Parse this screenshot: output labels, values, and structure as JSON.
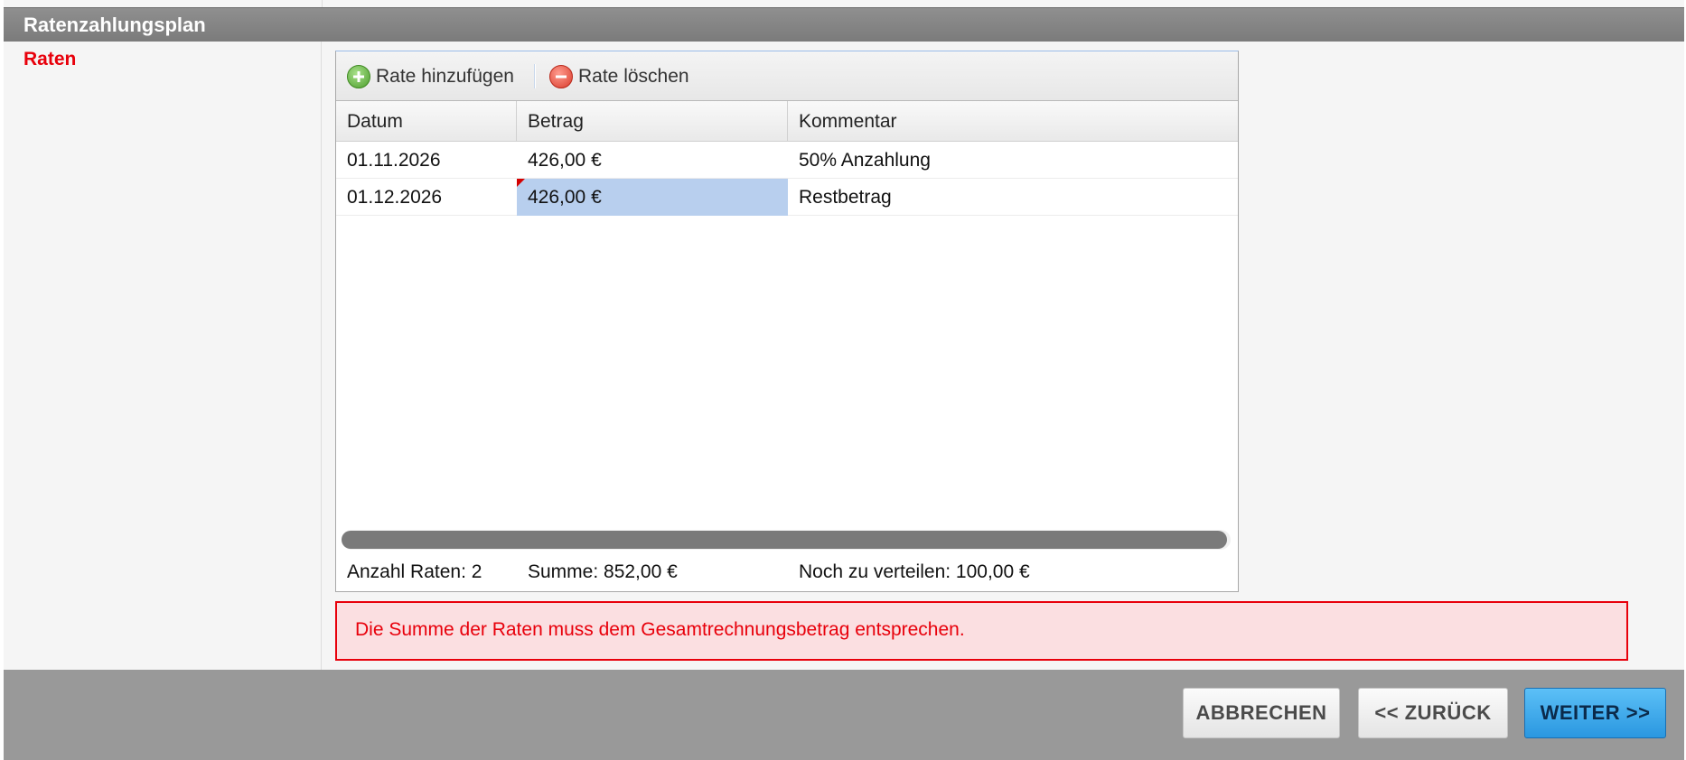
{
  "section": {
    "title": "Ratenzahlungsplan"
  },
  "field": {
    "label": "Raten"
  },
  "toolbar": {
    "add_label": "Rate hinzufügen",
    "delete_label": "Rate löschen"
  },
  "grid": {
    "columns": [
      "Datum",
      "Betrag",
      "Kommentar"
    ],
    "rows": [
      {
        "datum": "01.11.2026",
        "betrag": "426,00 €",
        "kommentar": "50% Anzahlung"
      },
      {
        "datum": "01.12.2026",
        "betrag": "426,00 €",
        "kommentar": "Restbetrag"
      }
    ]
  },
  "summary": {
    "count": "Anzahl Raten: 2",
    "sum": "Summe: 852,00 €",
    "remaining": "Noch zu verteilen: 100,00 €"
  },
  "error": {
    "message": "Die Summe der Raten muss dem Gesamtrechnungsbetrag entsprechen."
  },
  "footer": {
    "cancel_label": "ABBRECHEN",
    "back_label": "<< ZURÜCK",
    "next_label": "WEITER >>"
  },
  "colors": {
    "error_red": "#e8000b",
    "selection_blue": "#b8cfee",
    "primary_button": "#2a97e0",
    "header_grey": "#858585"
  },
  "icons": {
    "add": "plus-circle-icon",
    "delete": "minus-circle-icon"
  }
}
